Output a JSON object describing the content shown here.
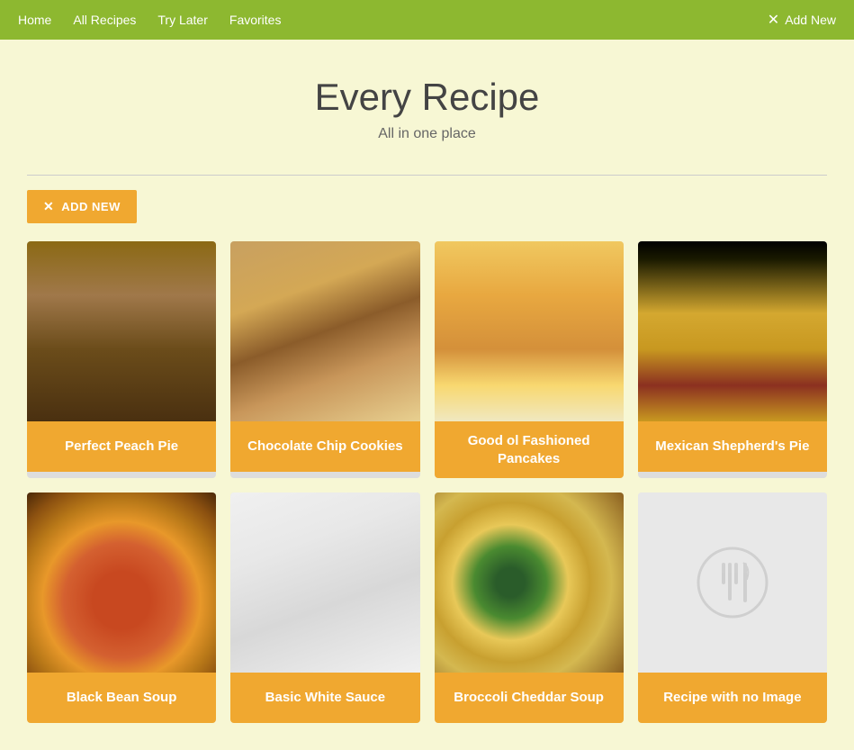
{
  "nav": {
    "links": [
      {
        "label": "Home",
        "id": "home"
      },
      {
        "label": "All Recipes",
        "id": "all-recipes"
      },
      {
        "label": "Try Later",
        "id": "try-later"
      },
      {
        "label": "Favorites",
        "id": "favorites"
      }
    ],
    "add_new_label": "Add New"
  },
  "hero": {
    "title": "Every Recipe",
    "subtitle": "All in one place"
  },
  "add_new_button": "ADD NEW",
  "recipes": [
    {
      "id": "perfect-peach-pie",
      "title": "Perfect Peach Pie",
      "img_class": "img-peach-pie"
    },
    {
      "id": "chocolate-chip-cookies",
      "title": "Chocolate Chip Cookies",
      "img_class": "img-choc-cookies"
    },
    {
      "id": "good-ol-fashioned-pancakes",
      "title": "Good ol Fashioned Pancakes",
      "img_class": "img-pancakes"
    },
    {
      "id": "mexican-shepherds-pie",
      "title": "Mexican Shepherd's Pie",
      "img_class": "img-mexican-pie"
    },
    {
      "id": "black-bean-soup",
      "title": "Black Bean Soup",
      "img_class": "img-black-bean"
    },
    {
      "id": "basic-white-sauce",
      "title": "Basic White Sauce",
      "img_class": "img-white-sauce"
    },
    {
      "id": "broccoli-cheddar-soup",
      "title": "Broccoli Cheddar Soup",
      "img_class": "img-broccoli-soup"
    },
    {
      "id": "default-recipe",
      "title": "Recipe with no Image",
      "img_class": "img-default"
    }
  ],
  "colors": {
    "nav_bg": "#8db830",
    "label_bg": "#f0a830",
    "hero_bg": "#f7f7d4"
  }
}
